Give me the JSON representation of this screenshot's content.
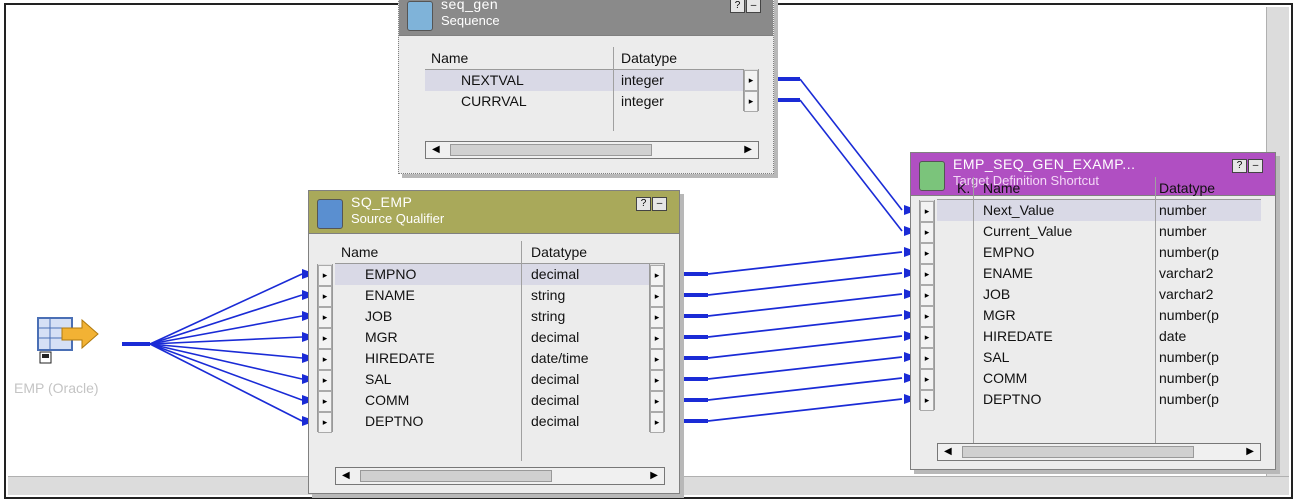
{
  "source_node": {
    "label": "EMP (Oracle)",
    "icon": "source-table-icon"
  },
  "seq_gen": {
    "name": "seq_gen",
    "kind": "Sequence",
    "header_color": "#8a8a8a",
    "columns": [
      "Name",
      "Datatype"
    ],
    "rows": [
      {
        "name": "NEXTVAL",
        "type": "integer"
      },
      {
        "name": "CURRVAL",
        "type": "integer"
      }
    ]
  },
  "source_qualifier": {
    "name": "SQ_EMP",
    "kind": "Source Qualifier",
    "header_color": "#a9a95a",
    "columns": [
      "Name",
      "Datatype"
    ],
    "rows": [
      {
        "name": "EMPNO",
        "type": "decimal"
      },
      {
        "name": "ENAME",
        "type": "string"
      },
      {
        "name": "JOB",
        "type": "string"
      },
      {
        "name": "MGR",
        "type": "decimal"
      },
      {
        "name": "HIREDATE",
        "type": "date/time"
      },
      {
        "name": "SAL",
        "type": "decimal"
      },
      {
        "name": "COMM",
        "type": "decimal"
      },
      {
        "name": "DEPTNO",
        "type": "decimal"
      }
    ]
  },
  "target": {
    "name": "EMP_SEQ_GEN_EXAMP...",
    "kind": "Target Definition Shortcut",
    "header_color": "#b04fc2",
    "columns": [
      "K.",
      "Name",
      "Datatype"
    ],
    "rows": [
      {
        "name": "Next_Value",
        "type": "number"
      },
      {
        "name": "Current_Value",
        "type": "number"
      },
      {
        "name": "EMPNO",
        "type": "number(p"
      },
      {
        "name": "ENAME",
        "type": "varchar2"
      },
      {
        "name": "JOB",
        "type": "varchar2"
      },
      {
        "name": "MGR",
        "type": "number(p"
      },
      {
        "name": "HIREDATE",
        "type": "date"
      },
      {
        "name": "SAL",
        "type": "number(p"
      },
      {
        "name": "COMM",
        "type": "number(p"
      },
      {
        "name": "DEPTNO",
        "type": "number(p"
      }
    ]
  },
  "controls": {
    "help": "?",
    "minimize": "–",
    "port_marker": "▸",
    "scroll_left": "◀",
    "scroll_right": "▶"
  },
  "colors": {
    "link": "#1a2bd6",
    "panel": "#ececec"
  }
}
